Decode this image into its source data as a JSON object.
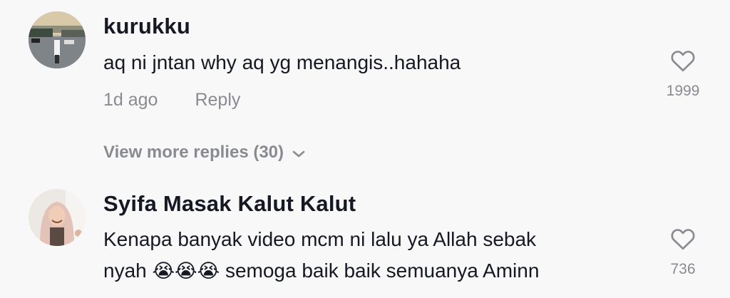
{
  "comments": [
    {
      "username": "kurukku",
      "text": "aq ni jntan why aq yg menangis..hahaha",
      "time": "1d ago",
      "reply_label": "Reply",
      "likes": "1999",
      "view_more": "View more replies (30)"
    },
    {
      "username": "Syifa Masak Kalut Kalut",
      "text_line1": "Kenapa banyak video mcm ni lalu ya Allah sebak",
      "text_line2_before": "nyah",
      "emoji": "😭😭😭",
      "text_line2_after": "semoga baik baik semuanya Aminn",
      "likes": "736"
    }
  ],
  "icons": {
    "heart": "heart-outline-icon",
    "chevron": "chevron-down-icon"
  },
  "colors": {
    "background": "#f8f8f8",
    "text": "#161823",
    "muted": "#8a8b91"
  }
}
